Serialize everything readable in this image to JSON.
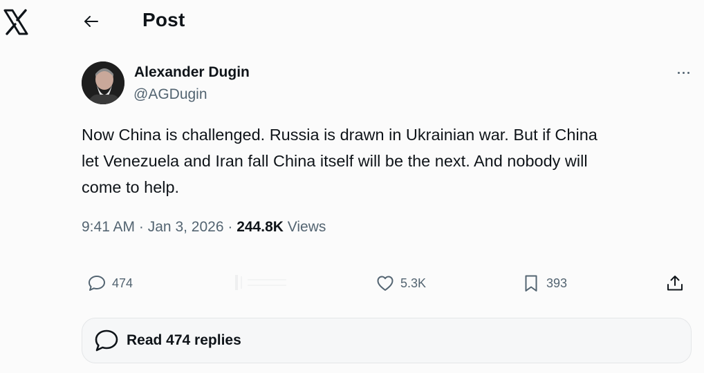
{
  "header": {
    "title": "Post"
  },
  "post": {
    "author_name": "Alexander Dugin",
    "author_handle": "@AGDugin",
    "text_lines": [
      "Now China is challenged. Russia is drawn in Ukrainian war. But if China",
      "let Venezuela and Iran fall China itself will be the next. And nobody will",
      "come to help."
    ],
    "time": "9:41 AM",
    "date": "Jan 3, 2026",
    "views_count": "244.8K",
    "views_label": "Views",
    "separator": "·"
  },
  "actions": {
    "replies": "474",
    "likes": "5.3K",
    "bookmarks": "393"
  },
  "read_replies": {
    "label": "Read 474 replies"
  },
  "icons": {
    "logo": "x-logo-icon",
    "back": "arrow-left-icon",
    "more": "more-dots-icon",
    "reply": "reply-bubble-icon",
    "repost": "repost-icon",
    "like": "heart-icon",
    "bookmark": "bookmark-icon",
    "share": "share-icon"
  }
}
